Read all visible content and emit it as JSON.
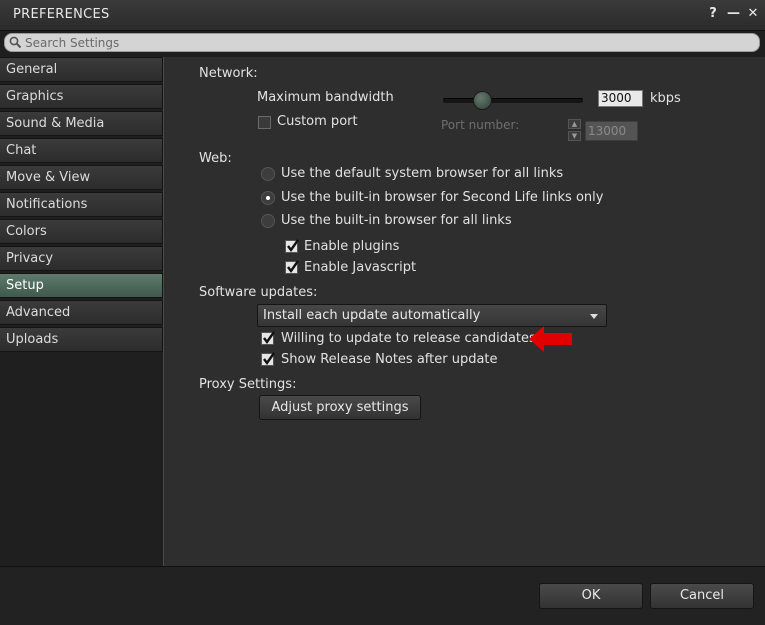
{
  "window": {
    "title": "PREFERENCES",
    "help_icon": "?",
    "minimize_icon": "—",
    "close_icon": "✕"
  },
  "search": {
    "placeholder": "Search Settings"
  },
  "sidebar": {
    "items": [
      {
        "label": "General"
      },
      {
        "label": "Graphics"
      },
      {
        "label": "Sound & Media"
      },
      {
        "label": "Chat"
      },
      {
        "label": "Move & View"
      },
      {
        "label": "Notifications"
      },
      {
        "label": "Colors"
      },
      {
        "label": "Privacy"
      },
      {
        "label": "Setup",
        "active": true
      },
      {
        "label": "Advanced"
      },
      {
        "label": "Uploads"
      }
    ]
  },
  "network": {
    "heading": "Network:",
    "max_bandwidth_label": "Maximum bandwidth",
    "bandwidth_value": "3000",
    "bandwidth_unit": "kbps",
    "bandwidth_slider_fraction": 0.3,
    "custom_port_label": "Custom port",
    "custom_port_checked": false,
    "port_number_label": "Port number:",
    "port_number_value": "13000"
  },
  "web": {
    "heading": "Web:",
    "options": [
      {
        "label": "Use the default system browser for all links",
        "selected": false
      },
      {
        "label": "Use the built-in browser for Second Life links only",
        "selected": true
      },
      {
        "label": "Use the built-in browser for all links",
        "selected": false
      }
    ],
    "enable_plugins_label": "Enable plugins",
    "enable_plugins_checked": true,
    "enable_javascript_label": "Enable Javascript",
    "enable_javascript_checked": true
  },
  "software_updates": {
    "heading": "Software updates:",
    "dropdown_value": "Install each update automatically",
    "release_candidates_label": "Willing to update to release candidates",
    "release_candidates_checked": true,
    "release_notes_label": "Show Release Notes after update",
    "release_notes_checked": true
  },
  "proxy": {
    "heading": "Proxy Settings:",
    "button_label": "Adjust proxy settings"
  },
  "footer": {
    "ok_label": "OK",
    "cancel_label": "Cancel"
  },
  "colors": {
    "accent": "#4f6b5d",
    "annotation_arrow": "#e00000"
  }
}
